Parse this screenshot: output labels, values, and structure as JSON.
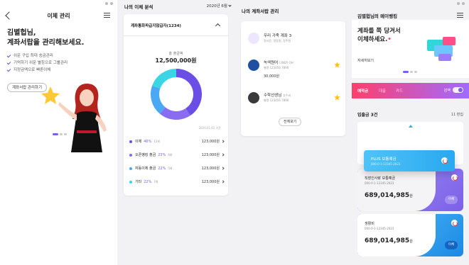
{
  "panel1": {
    "title": "이체 관리",
    "headline_line1": "김별헙님,",
    "headline_line2": "계좌서랍을 관리해보세요.",
    "features": [
      "쉬운 구입 최대 송금관리",
      "기억하기 쉬운 별칭으로 그룹관리",
      "지정금액으로 빠른이체"
    ],
    "start_button": "계좌서랍 관리하기"
  },
  "panel2": {
    "title": "나의 이체 분석",
    "date": "2020년 6월",
    "account": "계좌통화파급지않급자(1234)",
    "total_label": "총 출금액",
    "total_value": "12,500,000원",
    "as_of": "2020.01.01 기준",
    "legend": [
      {
        "name": "이체",
        "pct": "46%",
        "count": "12회",
        "amount": "123,000원",
        "color": "#6a4ee6"
      },
      {
        "name": "오픈뱅킹 출금",
        "pct": "23%",
        "count": "6회",
        "amount": "123,000원",
        "color": "#8a6cf0"
      },
      {
        "name": "자동이체 출금",
        "pct": "22%",
        "count": "5회",
        "amount": "123,000원",
        "color": "#4aa8f5"
      },
      {
        "name": "기타",
        "pct": "22%",
        "count": "7회",
        "amount": "123,000원",
        "color": "#3bd6e6"
      }
    ],
    "chart_data": {
      "type": "pie",
      "categories": [
        "이체",
        "오픈뱅킹 출금",
        "자동이체 출금",
        "기타"
      ],
      "values": [
        46,
        23,
        22,
        22
      ],
      "title": "총 출금액",
      "colors": [
        "#6a4ee6",
        "#8a6cf0",
        "#4aa8f5",
        "#3bd6e6"
      ]
    }
  },
  "panel3": {
    "title": "나의 계좌서랍 관리",
    "accounts": [
      {
        "name": "우리 가족 계좌 3",
        "sub": "정서윤, 정동원, 정주원",
        "balance": "",
        "color": "#7a5cf0",
        "starred": false
      },
      {
        "name": "녹색원어",
        "sub": "CINDY OH",
        "sub2": "별명 123456 7890",
        "balance": "30,000원",
        "color": "#1e4fa0",
        "starred": true
      },
      {
        "name": "수학선생님",
        "sub": "승수씨",
        "sub2": "별명 123456 7890",
        "balance": "",
        "color": "#3a3a3a",
        "starred": true
      }
    ],
    "more_button": "전체보기"
  },
  "panel4": {
    "title": "김별헙님의 메이뱅킹",
    "hero_line1": "계좌를 쪽 당겨서",
    "hero_line2": "이체하세요.",
    "hero_button": "자세히보기",
    "tabs": [
      "예적금",
      "대출",
      "카드"
    ],
    "filter_label": "감액",
    "list_header": "입출금 3건",
    "edit_label": "11 편집",
    "cards": [
      {
        "name": "PLUS 보통예금",
        "no": "000-0-1-12345-2023",
        "balance": ""
      },
      {
        "name": "직장인사랑 보통예금",
        "no": "000-0-1-12345-2023",
        "balance": "689,014,985",
        "unit": "원",
        "button": "이체"
      },
      {
        "name": "생활비",
        "no": "000-0-1-12345-2023",
        "balance": "689,014,985",
        "unit": "원",
        "button": "이체"
      }
    ],
    "accent_gradient": [
      "#ff3f6c",
      "#a06bff"
    ]
  }
}
